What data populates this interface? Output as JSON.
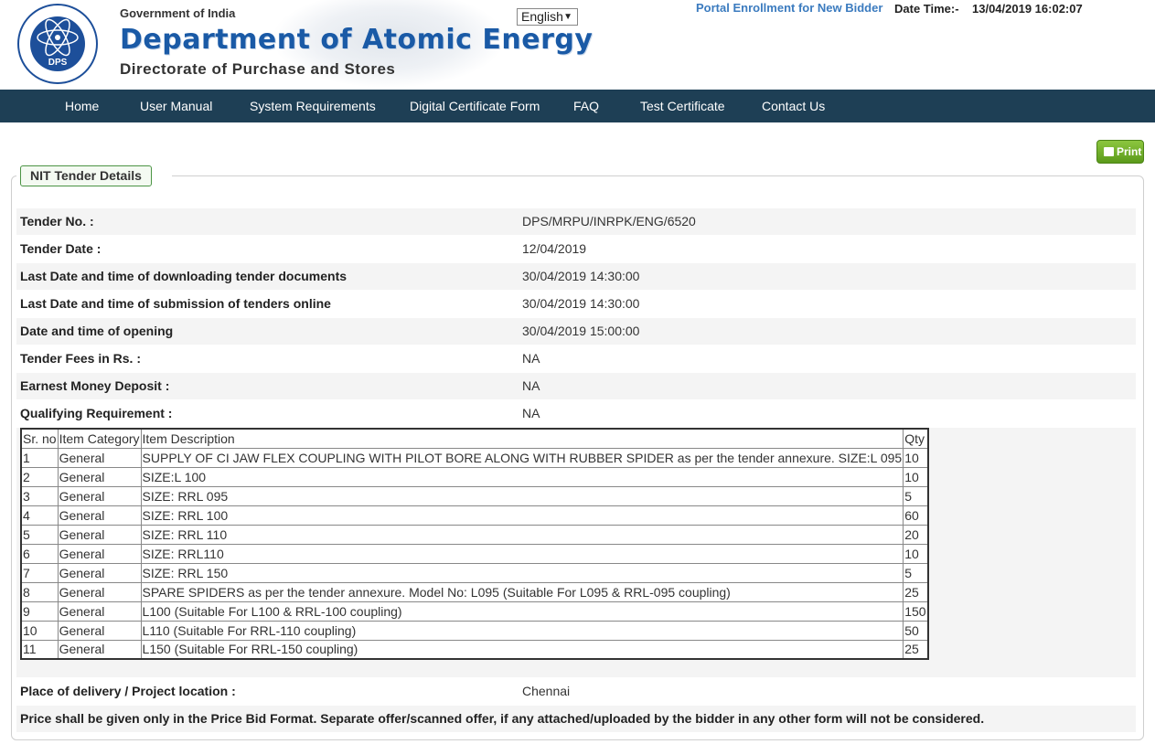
{
  "header": {
    "logo_text": "DPS",
    "gov": "Government of India",
    "dept": "Department of Atomic Energy",
    "directorate": "Directorate of Purchase and Stores",
    "language": "English",
    "portal_link": "Portal Enrollment for New Bidder",
    "datetime_label": "Date Time:-",
    "datetime_value": "13/04/2019 16:02:07"
  },
  "nav": [
    "Home",
    "User Manual",
    "System Requirements",
    "Digital Certificate Form",
    "FAQ",
    "Test Certificate",
    "Contact Us"
  ],
  "print_label": "Print",
  "section_title": "NIT Tender Details",
  "details": [
    {
      "label": "Tender No. :",
      "value": "DPS/MRPU/INRPK/ENG/6520"
    },
    {
      "label": "Tender Date :",
      "value": "12/04/2019"
    },
    {
      "label": "Last Date and time of downloading tender documents",
      "value": "30/04/2019 14:30:00"
    },
    {
      "label": "Last Date and time of submission of tenders online",
      "value": "30/04/2019 14:30:00"
    },
    {
      "label": "Date and time of opening",
      "value": "30/04/2019 15:00:00"
    },
    {
      "label": "Tender Fees in Rs. :",
      "value": "NA"
    },
    {
      "label": "Earnest Money Deposit :",
      "value": "NA"
    },
    {
      "label": "Qualifying Requirement :",
      "value": "NA"
    }
  ],
  "items": {
    "headers": [
      "Sr. no",
      "Item Category",
      "Item Description",
      "Qty"
    ],
    "rows": [
      [
        "1",
        "General",
        "SUPPLY OF CI JAW FLEX COUPLING WITH PILOT BORE ALONG WITH RUBBER SPIDER as per the tender annexure. SIZE:L 095",
        "10"
      ],
      [
        "2",
        "General",
        "SIZE:L 100",
        "10"
      ],
      [
        "3",
        "General",
        "SIZE: RRL 095",
        "5"
      ],
      [
        "4",
        "General",
        "SIZE: RRL 100",
        "60"
      ],
      [
        "5",
        "General",
        "SIZE: RRL 110",
        "20"
      ],
      [
        "6",
        "General",
        "SIZE: RRL110",
        "10"
      ],
      [
        "7",
        "General",
        "SIZE: RRL 150",
        "5"
      ],
      [
        "8",
        "General",
        "SPARE SPIDERS as per the tender annexure. Model No: L095 (Suitable For L095 & RRL-095 coupling)",
        "25"
      ],
      [
        "9",
        "General",
        "L100 (Suitable For L100 & RRL-100 coupling)",
        "150"
      ],
      [
        "10",
        "General",
        "L110 (Suitable For RRL-110 coupling)",
        "50"
      ],
      [
        "11",
        "General",
        "L150 (Suitable For RRL-150 coupling)",
        "25"
      ]
    ]
  },
  "delivery": {
    "label": "Place of delivery / Project location :",
    "value": "Chennai"
  },
  "note": "Price shall be given only in the Price Bid Format. Separate offer/scanned offer, if any attached/uploaded by the bidder in any other form will not be considered."
}
